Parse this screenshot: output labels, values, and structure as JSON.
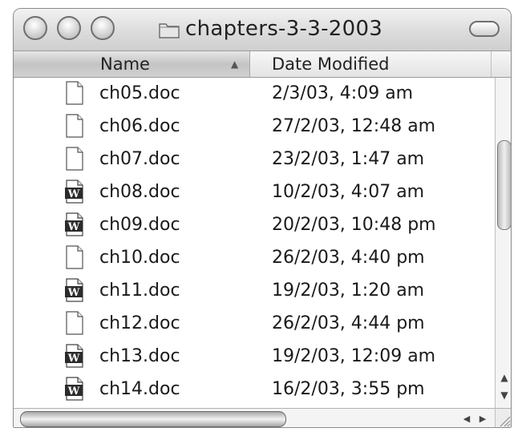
{
  "window": {
    "title": "chapters-3-3-2003"
  },
  "columns": {
    "name": "Name",
    "date_modified": "Date Modified"
  },
  "files": [
    {
      "name": "ch05.doc",
      "date": "2/3/03, 4:09 am",
      "icon": "blank-document-icon"
    },
    {
      "name": "ch06.doc",
      "date": "27/2/03, 12:48 am",
      "icon": "blank-document-icon"
    },
    {
      "name": "ch07.doc",
      "date": "23/2/03, 1:47 am",
      "icon": "blank-document-icon"
    },
    {
      "name": "ch08.doc",
      "date": "10/2/03, 4:07 am",
      "icon": "word-document-icon"
    },
    {
      "name": "ch09.doc",
      "date": "20/2/03, 10:48 pm",
      "icon": "word-document-icon"
    },
    {
      "name": "ch10.doc",
      "date": "26/2/03, 4:40 pm",
      "icon": "blank-document-icon"
    },
    {
      "name": "ch11.doc",
      "date": "19/2/03, 1:20 am",
      "icon": "word-document-icon"
    },
    {
      "name": "ch12.doc",
      "date": "26/2/03, 4:44 pm",
      "icon": "blank-document-icon"
    },
    {
      "name": "ch13.doc",
      "date": "19/2/03, 12:09 am",
      "icon": "word-document-icon"
    },
    {
      "name": "ch14.doc",
      "date": "16/2/03, 3:55 pm",
      "icon": "word-document-icon"
    }
  ]
}
